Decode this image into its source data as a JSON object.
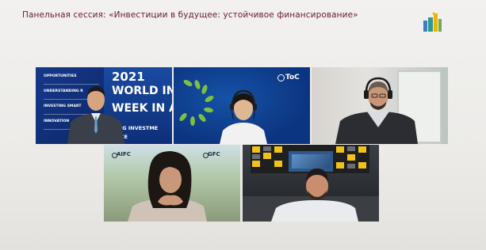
{
  "header": {
    "title": "Панельная сессия: «Инвестиции в будущее: устойчивое финансирование»"
  },
  "event_logo": {
    "icon": "city-skyline-icon",
    "colors": [
      "#f2b200",
      "#2a9d8f",
      "#3c7dc4"
    ]
  },
  "participants": [
    {
      "id": "p1",
      "icon": "person-icon",
      "background": {
        "menu_items": [
          "OPPORTUNITIES",
          "UNDERSTANDING R",
          "INVESTING SMART",
          "INNOVATION"
        ],
        "year": "2021",
        "line1": "WORLD IN",
        "line2": "WEEK IN A",
        "line3": "TING INVESTME",
        "line4": "ENCE"
      }
    },
    {
      "id": "p2",
      "icon": "person-icon",
      "background": {
        "logo": "ToC"
      }
    },
    {
      "id": "p3",
      "icon": "person-icon"
    },
    {
      "id": "p4",
      "icon": "person-icon",
      "background": {
        "logo_left": "AIFC",
        "logo_right": "GFC"
      }
    },
    {
      "id": "p5",
      "icon": "person-icon"
    }
  ],
  "colors": {
    "title_text": "#6a1a2a",
    "brand_blue": "#12327d",
    "accent_yellow": "#f2c21b",
    "accent_green": "#2e9e4a"
  }
}
